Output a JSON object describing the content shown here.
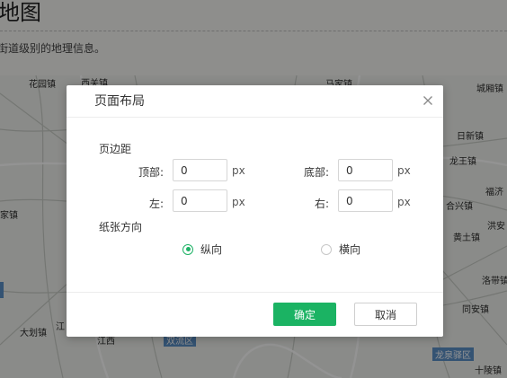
{
  "background": {
    "title": "地图",
    "description": "街道级别的地理信息。",
    "map_labels": {
      "huayuan": "花园镇",
      "xiguan": "西关镇",
      "majia": "马家镇",
      "chengxiang": "城厢镇",
      "rixin": "日新镇",
      "longwang": "龙王镇",
      "fuji": "福济",
      "hexing": "合兴镇",
      "hongan": "洪安",
      "huangtu": "黄土镇",
      "jiazhen": "家镇",
      "luodai": "洛带镇",
      "tongan": "同安镇",
      "dahua": "大划镇",
      "jiang": "江",
      "longquan": "龙泉驿区",
      "shiling": "十陵镇",
      "shuangliu": "双流区",
      "jiangxi": "江西"
    }
  },
  "dialog": {
    "title": "页面布局",
    "close_icon": "close-icon",
    "margins_label": "页边距",
    "top_label": "顶部:",
    "top_value": "0",
    "bottom_label": "底部:",
    "bottom_value": "0",
    "left_label": "左:",
    "left_value": "0",
    "right_label": "右:",
    "right_value": "0",
    "unit": "px",
    "orientation_label": "纸张方向",
    "portrait_label": "纵向",
    "landscape_label": "横向",
    "selected_orientation": "portrait",
    "confirm_label": "确定",
    "cancel_label": "取消"
  },
  "colors": {
    "accent": "#1bb363",
    "overlay": "rgba(0,0,0,0.42)"
  }
}
